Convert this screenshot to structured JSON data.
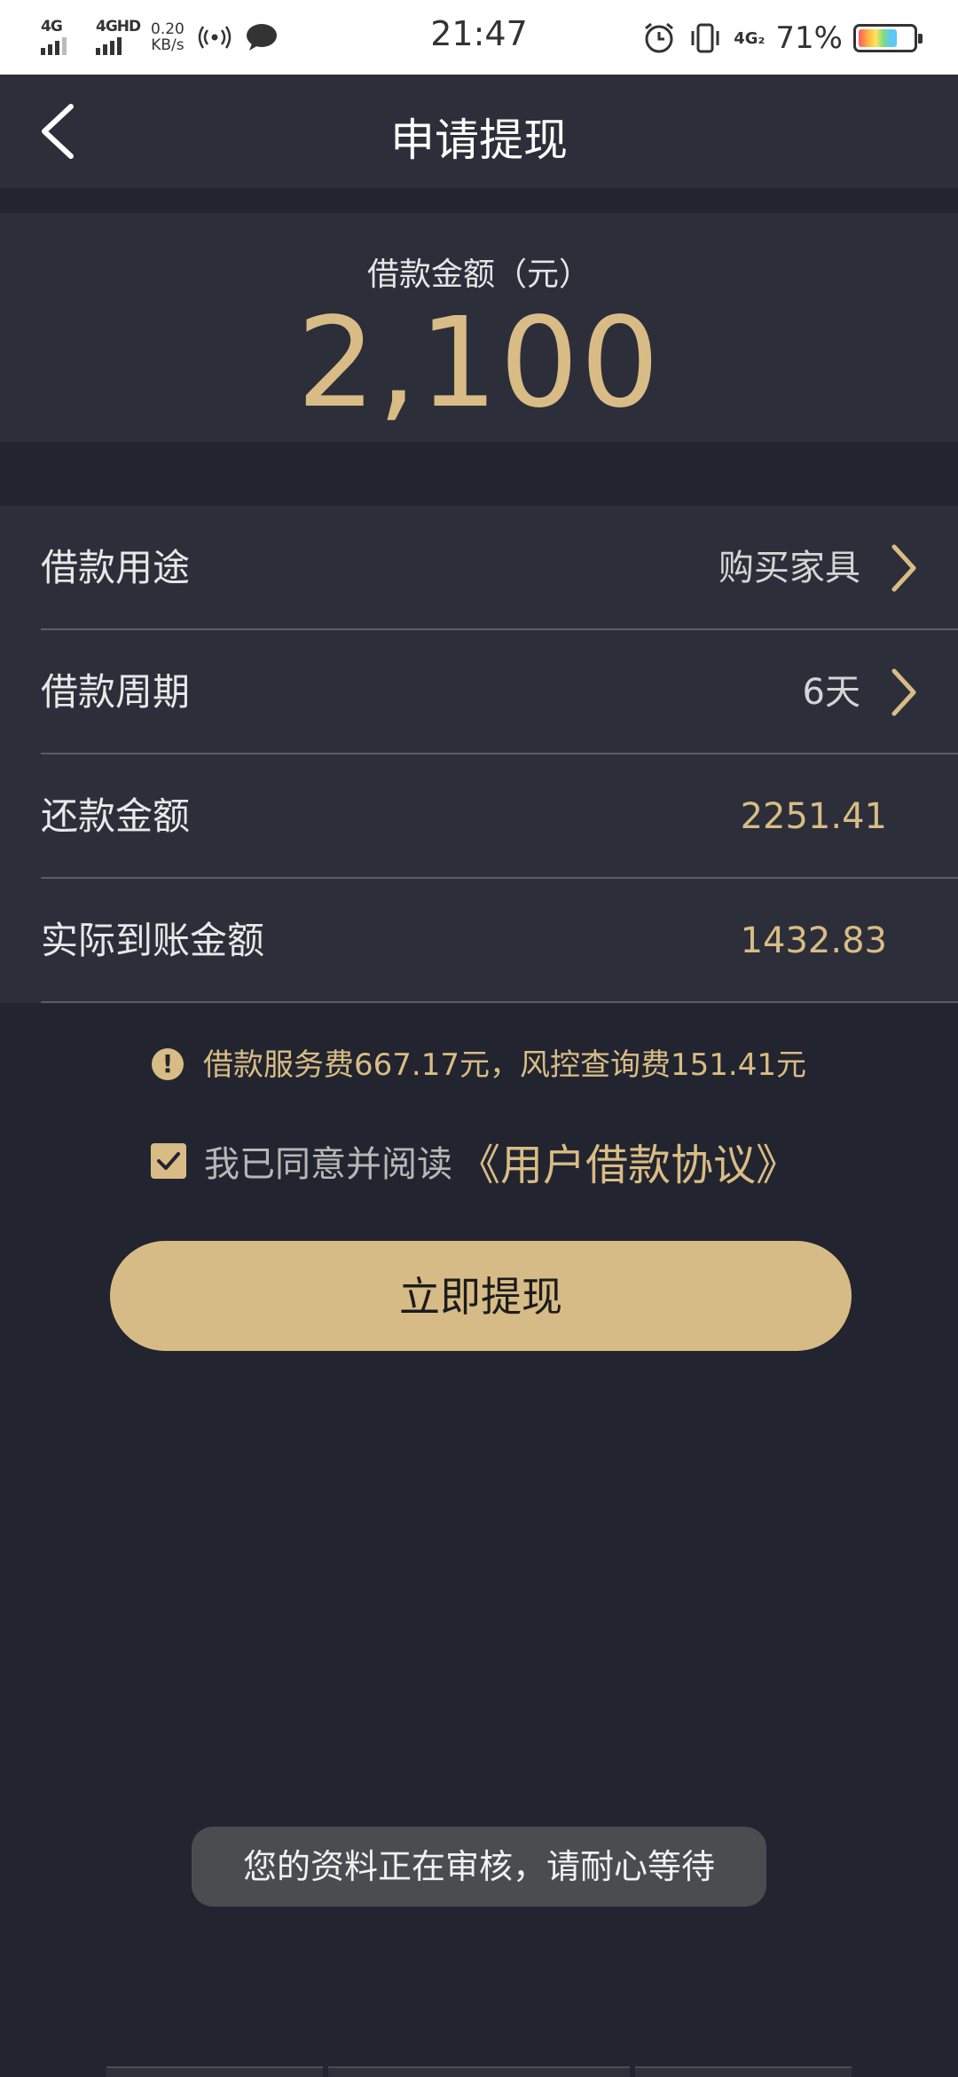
{
  "status_bar": {
    "signal1_label": "4G",
    "signal2_label": "4GHD",
    "net_speed_value": "0.20",
    "net_speed_unit": "KB/s",
    "time": "21:47",
    "sim_label": "4G₂",
    "battery_percent": "71%",
    "battery_level": 0.71,
    "icons": [
      "signal-icon",
      "hotspot-icon",
      "chat-icon",
      "alarm-icon",
      "vibrate-icon",
      "battery-icon"
    ]
  },
  "header": {
    "title": "申请提现",
    "back_icon": "chevron-left-icon"
  },
  "amount": {
    "label": "借款金额（元）",
    "value": "2,100"
  },
  "rows": [
    {
      "label": "借款用途",
      "value": "购买家具",
      "has_arrow": true
    },
    {
      "label": "借款周期",
      "value": "6天",
      "has_arrow": true
    },
    {
      "label": "还款金额",
      "value": "2251.41",
      "has_arrow": false
    },
    {
      "label": "实际到账金额",
      "value": "1432.83",
      "has_arrow": false
    }
  ],
  "notice": {
    "icon_text": "!",
    "text": "借款服务费667.17元，风控查询费151.41元"
  },
  "agreement": {
    "checked": true,
    "text": "我已同意并阅读",
    "link": "《用户借款协议》"
  },
  "submit_label": "立即提现",
  "toast": "您的资料正在审核，请耐心等待",
  "colors": {
    "accent": "#d9bc85",
    "background": "#22252f",
    "card": "#2c2f3a"
  }
}
